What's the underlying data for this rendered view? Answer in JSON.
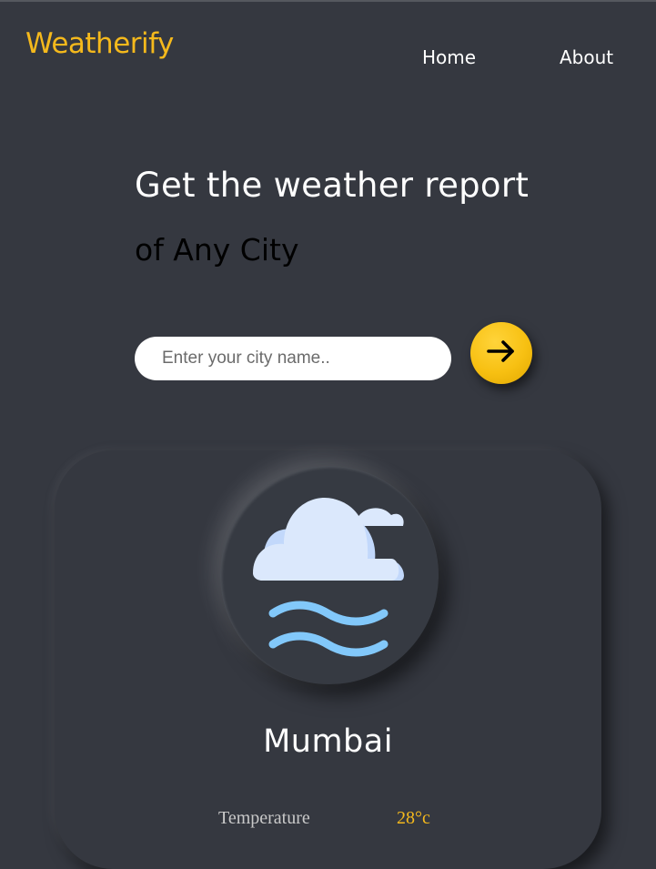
{
  "header": {
    "brand": "Weatherify",
    "nav": [
      {
        "label": "Home"
      },
      {
        "label": "About"
      }
    ]
  },
  "hero": {
    "title": "Get the weather report",
    "subtitle": "of Any City"
  },
  "search": {
    "placeholder": "Enter your city name..",
    "value": "",
    "submit_icon": "arrow-right-icon"
  },
  "weather": {
    "condition_icon": "cloud-fog-icon",
    "city": "Mumbai",
    "stats": [
      {
        "label": "Temperature",
        "value": "28°c"
      }
    ]
  },
  "colors": {
    "background": "#353840",
    "accent": "#f5b91c",
    "text": "#ffffff",
    "cloud": "#dbe8fc",
    "fog": "#82c8fa"
  }
}
